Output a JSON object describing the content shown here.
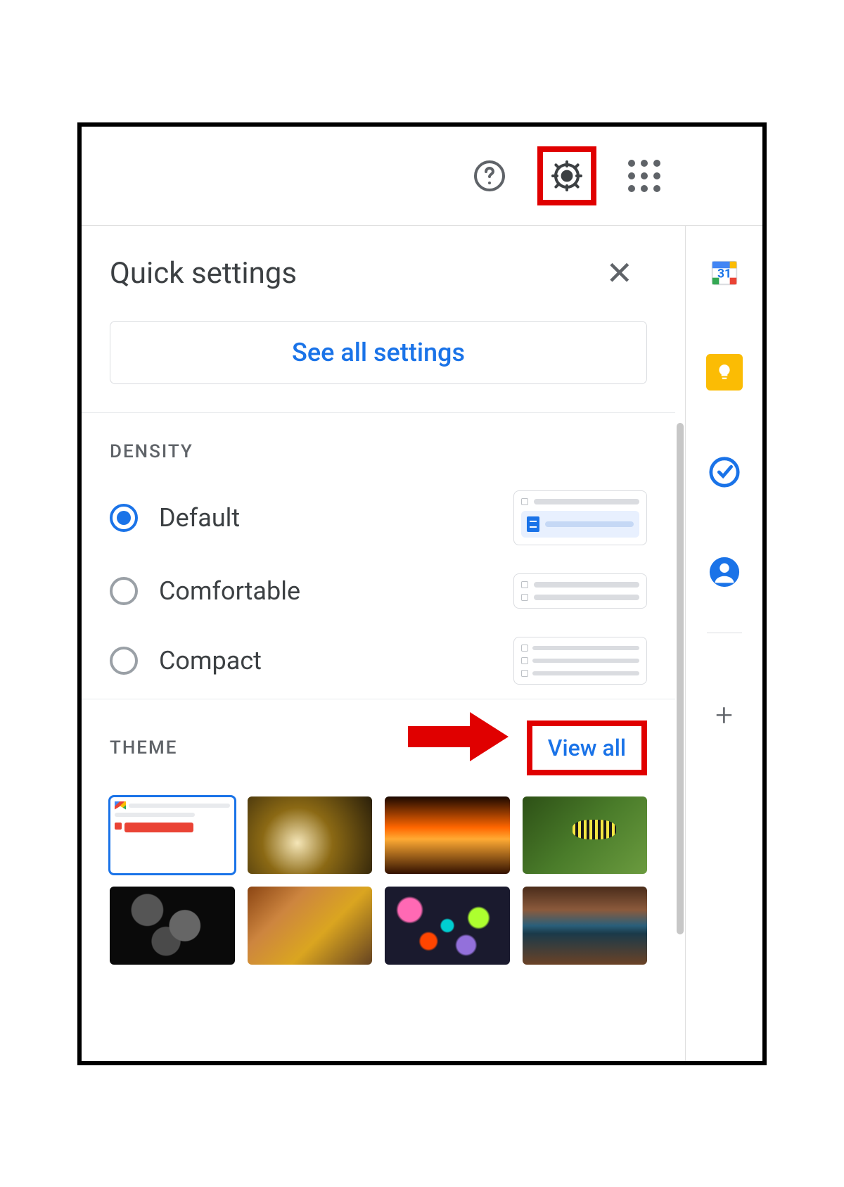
{
  "header": {
    "help_icon": "help-icon",
    "settings_icon": "gear-icon",
    "apps_icon": "apps-grid-icon"
  },
  "panel": {
    "title": "Quick settings",
    "close_label": "✕",
    "see_all_label": "See all settings"
  },
  "density": {
    "section_label": "DENSITY",
    "options": [
      {
        "label": "Default",
        "selected": true
      },
      {
        "label": "Comfortable",
        "selected": false
      },
      {
        "label": "Compact",
        "selected": false
      }
    ]
  },
  "theme": {
    "section_label": "THEME",
    "view_all_label": "View all",
    "tiles": [
      {
        "name": "default-light",
        "selected": true
      },
      {
        "name": "chess",
        "selected": false
      },
      {
        "name": "canyon-glow",
        "selected": false
      },
      {
        "name": "caterpillar-green",
        "selected": false
      },
      {
        "name": "dark-bubbles",
        "selected": false
      },
      {
        "name": "autumn-leaves",
        "selected": false
      },
      {
        "name": "bokeh-lights",
        "selected": false
      },
      {
        "name": "horseshoe-bend",
        "selected": false
      }
    ]
  },
  "sidepanel": {
    "items": [
      {
        "name": "calendar-icon",
        "label": "31"
      },
      {
        "name": "keep-icon"
      },
      {
        "name": "tasks-icon"
      },
      {
        "name": "contacts-icon"
      }
    ],
    "add_label": "+"
  },
  "annotations": {
    "gear_highlighted": true,
    "view_all_highlighted": true,
    "arrow_points_to": "view-all"
  }
}
